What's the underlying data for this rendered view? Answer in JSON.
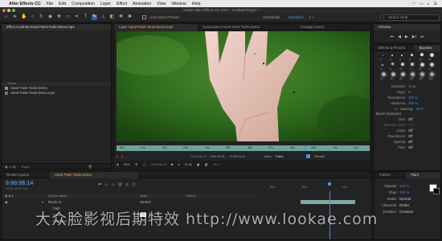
{
  "menubar": {
    "items": [
      "After Effects CC",
      "File",
      "Edit",
      "Composition",
      "Layer",
      "Effect",
      "Animation",
      "View",
      "Window",
      "Help"
    ]
  },
  "titlebar": {
    "title": "Adobe After Effects CC 2017 - Untitled Project *"
  },
  "toolbar": {
    "auto_open": "Auto-Open Panels",
    "workspaces": [
      "Essentials",
      "Standard"
    ],
    "search_placeholder": "Search Help"
  },
  "project": {
    "tab": "Effect Controls Hand-Paint-Tools-Demo.mp4",
    "col_name": "Name",
    "items": [
      "Hand-Paint-Tools-Demo",
      "Hand-Paint-Tools-Demo.mp4"
    ],
    "bpc": "8 bpc"
  },
  "viewer": {
    "tabs": [
      "Layer Hand-Paint-Tools-Demo.mp4",
      "Composition Hand-Paint-Tools-Demo",
      "Footage (none)"
    ],
    "ruler": [
      "00s",
      "01s",
      "02s",
      "03s",
      "04s",
      "05s",
      "06s",
      "07s",
      "08s",
      "09s",
      "10s",
      "11s"
    ],
    "time": "0:00:08:14",
    "duration": "0:00:11:11",
    "delta": "+0:00:11:11",
    "zoom": "50%",
    "res": "(Full)",
    "view_label": "View:",
    "view_value": "Paint",
    "render": "Render",
    "frame_val": "0:00:08:14",
    "offset": "+0.0"
  },
  "preview": {
    "tab": "Preview"
  },
  "brushes": {
    "tabs": [
      "Effects & Presets",
      "Brushes"
    ],
    "sizes": [
      "1",
      "3",
      "5",
      "9",
      "13",
      "19",
      "5",
      "9",
      "13",
      "17",
      "21",
      "27",
      "35",
      "45",
      "65",
      "100",
      "200",
      "300"
    ],
    "diameter_label": "Diameter:",
    "diameter": "19 px",
    "angle_label": "Angle:",
    "angle": "0 °",
    "roundness_label": "Roundness:",
    "roundness": "100 %",
    "hardness_label": "Hardness:",
    "hardness": "100 %",
    "spacing_label": "Spacing:",
    "spacing": "25 %",
    "dynamics": "Brush Dynamics",
    "size_label": "Size:",
    "size": "Off",
    "min_size_label": "Minimum Size:",
    "min_size": "1 %",
    "angle2_label": "Angle:",
    "angle2": "Off",
    "roundness2_label": "Roundness:",
    "roundness2": "Off",
    "opacity_label": "Opacity:",
    "opacity": "Off",
    "flow_label": "Flow:",
    "flow": "Off"
  },
  "timeline": {
    "render_queue": "Render Queue",
    "comp_tab": "Hand-Paint-Tools-Demo",
    "timecode": "0:00:08:14",
    "frames": "00254 (29.97 fps)",
    "col_source": "Source Name",
    "col_mode": "Mode",
    "col_parent": "Parent",
    "layer": "Brush 11",
    "layer_mode": "Normal",
    "sub": [
      "Path",
      "Color",
      "Diameter"
    ],
    "diameter_val": "19.0",
    "track_labels": [
      "00s",
      "05s",
      "10s"
    ]
  },
  "tracker": {
    "tabs": [
      "Tracker",
      "Paint"
    ],
    "opacity_label": "Opacity:",
    "opacity": "100 %",
    "flow_label": "Flow:",
    "flow": "100 %",
    "mode_label": "Mode:",
    "mode": "Normal",
    "channels_label": "Channels:",
    "channels": "RGBA",
    "duration_label": "Duration:",
    "duration": "Constant"
  },
  "watermark": {
    "text": "大众脸影视后期特效  http://www.lookae.com"
  },
  "colors": {
    "accent": "#4a8fe0",
    "comp_label": "#e8b36a",
    "ruler": "#6ea39a",
    "footage_green": "#2f6a1d"
  }
}
